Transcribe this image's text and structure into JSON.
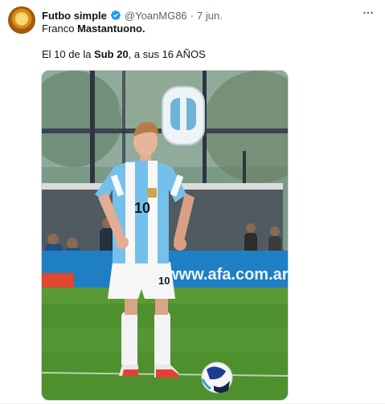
{
  "tweet": {
    "author_name": "Futbo simple",
    "handle": "@YoanMG86",
    "separator": "·",
    "date": "7 jun.",
    "line1": {
      "normal": "Franco ",
      "bold": "Mastantuono."
    },
    "line2": {
      "p1": "El 10 de la ",
      "b1": "Sub 20",
      "p2": ", a sus 16 AÑOS"
    },
    "more_icon": "more-horizontal-icon",
    "verified_color": "#1d9bf0"
  },
  "media": {
    "jersey_number": "10",
    "shorts_number": "10",
    "banner_text": "www.afa.com.ar",
    "banner_color": "#1f7fc4",
    "shirt_sky_blue": "#75c0ea",
    "grass_color": "#4e8f2e"
  }
}
